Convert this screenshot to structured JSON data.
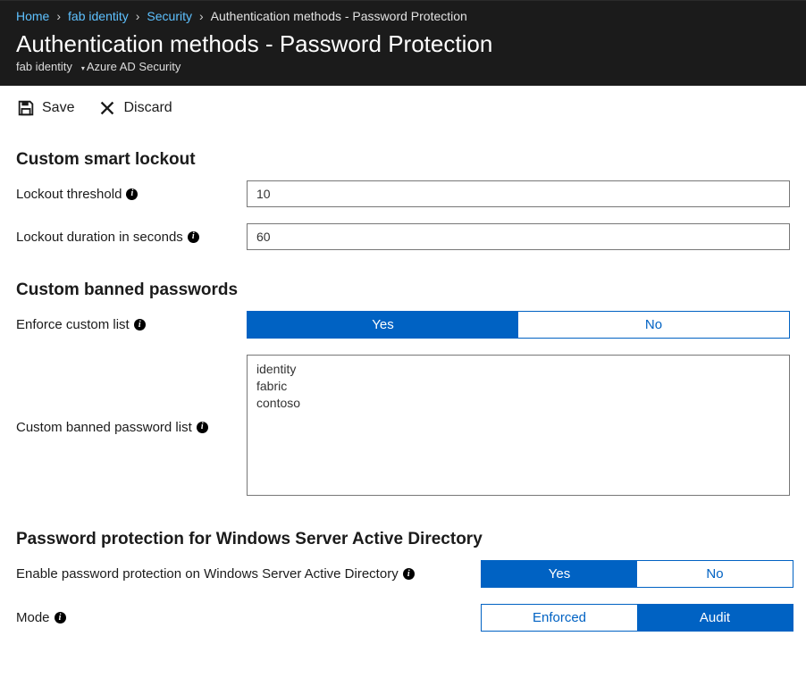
{
  "breadcrumb": {
    "home": "Home",
    "tenant": "fab identity",
    "security": "Security",
    "current": "Authentication methods - Password Protection"
  },
  "page": {
    "title": "Authentication methods - Password Protection",
    "sub_tenant": "fab identity",
    "sub_section": "Azure AD Security"
  },
  "toolbar": {
    "save": "Save",
    "discard": "Discard"
  },
  "sections": {
    "lockout_title": "Custom smart lockout",
    "lockout_threshold_label": "Lockout threshold",
    "lockout_threshold_value": "10",
    "lockout_duration_label": "Lockout duration in seconds",
    "lockout_duration_value": "60",
    "banned_title": "Custom banned passwords",
    "enforce_label": "Enforce custom list",
    "enforce_yes": "Yes",
    "enforce_no": "No",
    "banned_list_label": "Custom banned password list",
    "banned_list_value": "identity\nfabric\ncontoso",
    "winad_title": "Password protection for Windows Server Active Directory",
    "winad_enable_label": "Enable password protection on Windows Server Active Directory",
    "winad_yes": "Yes",
    "winad_no": "No",
    "mode_label": "Mode",
    "mode_enforced": "Enforced",
    "mode_audit": "Audit"
  }
}
